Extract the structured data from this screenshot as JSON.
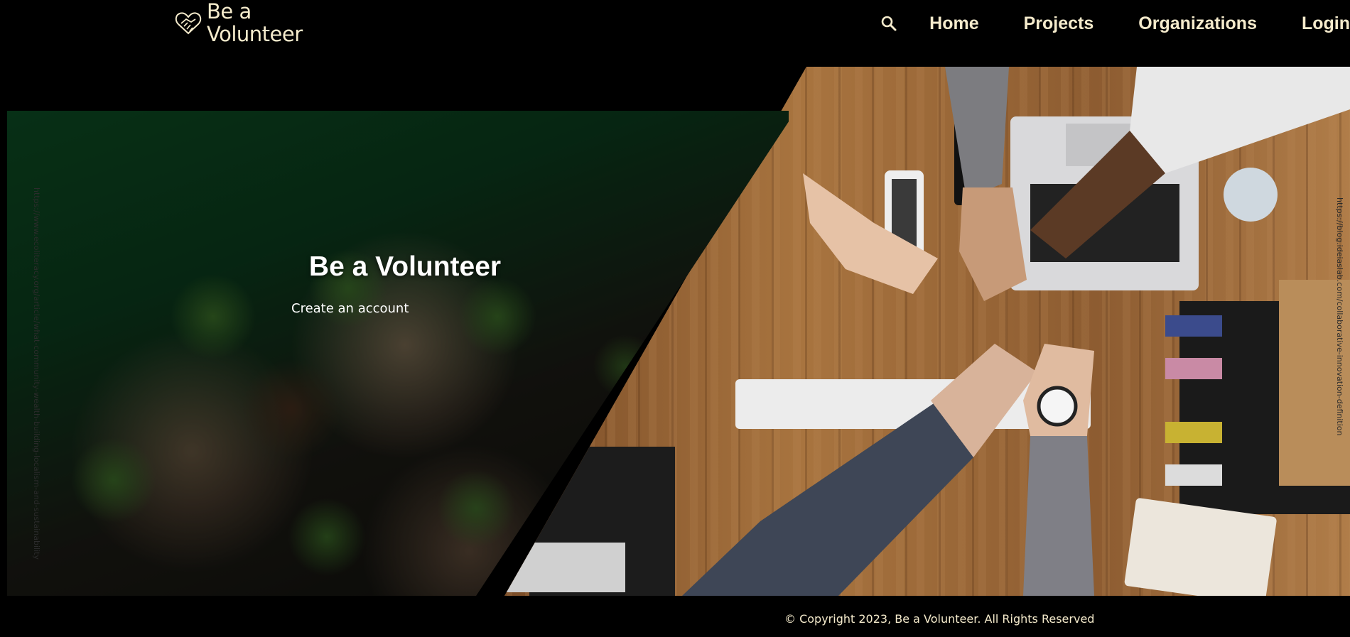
{
  "brand": {
    "line1": "Be a",
    "line2": "Volunteer",
    "icon": "heart-handshake-icon"
  },
  "nav": {
    "search_icon": "search-icon",
    "items": [
      "Home",
      "Projects",
      "Organizations",
      "Login"
    ]
  },
  "hero": {
    "title": "Be a Volunteer",
    "cta": "Create an account",
    "credit_left": "https://www.ecoliteracy.org/article/what-community-wealth-building-localism-and-sustainability",
    "credit_right": "https://blog.ideiaslab.com/collaborative-innovation-definition"
  },
  "footer": {
    "copyright": "© Copyright 2023, Be a Volunteer. All Rights Reserved"
  },
  "colors": {
    "accent": "#f5ebcc",
    "background": "#000000"
  }
}
